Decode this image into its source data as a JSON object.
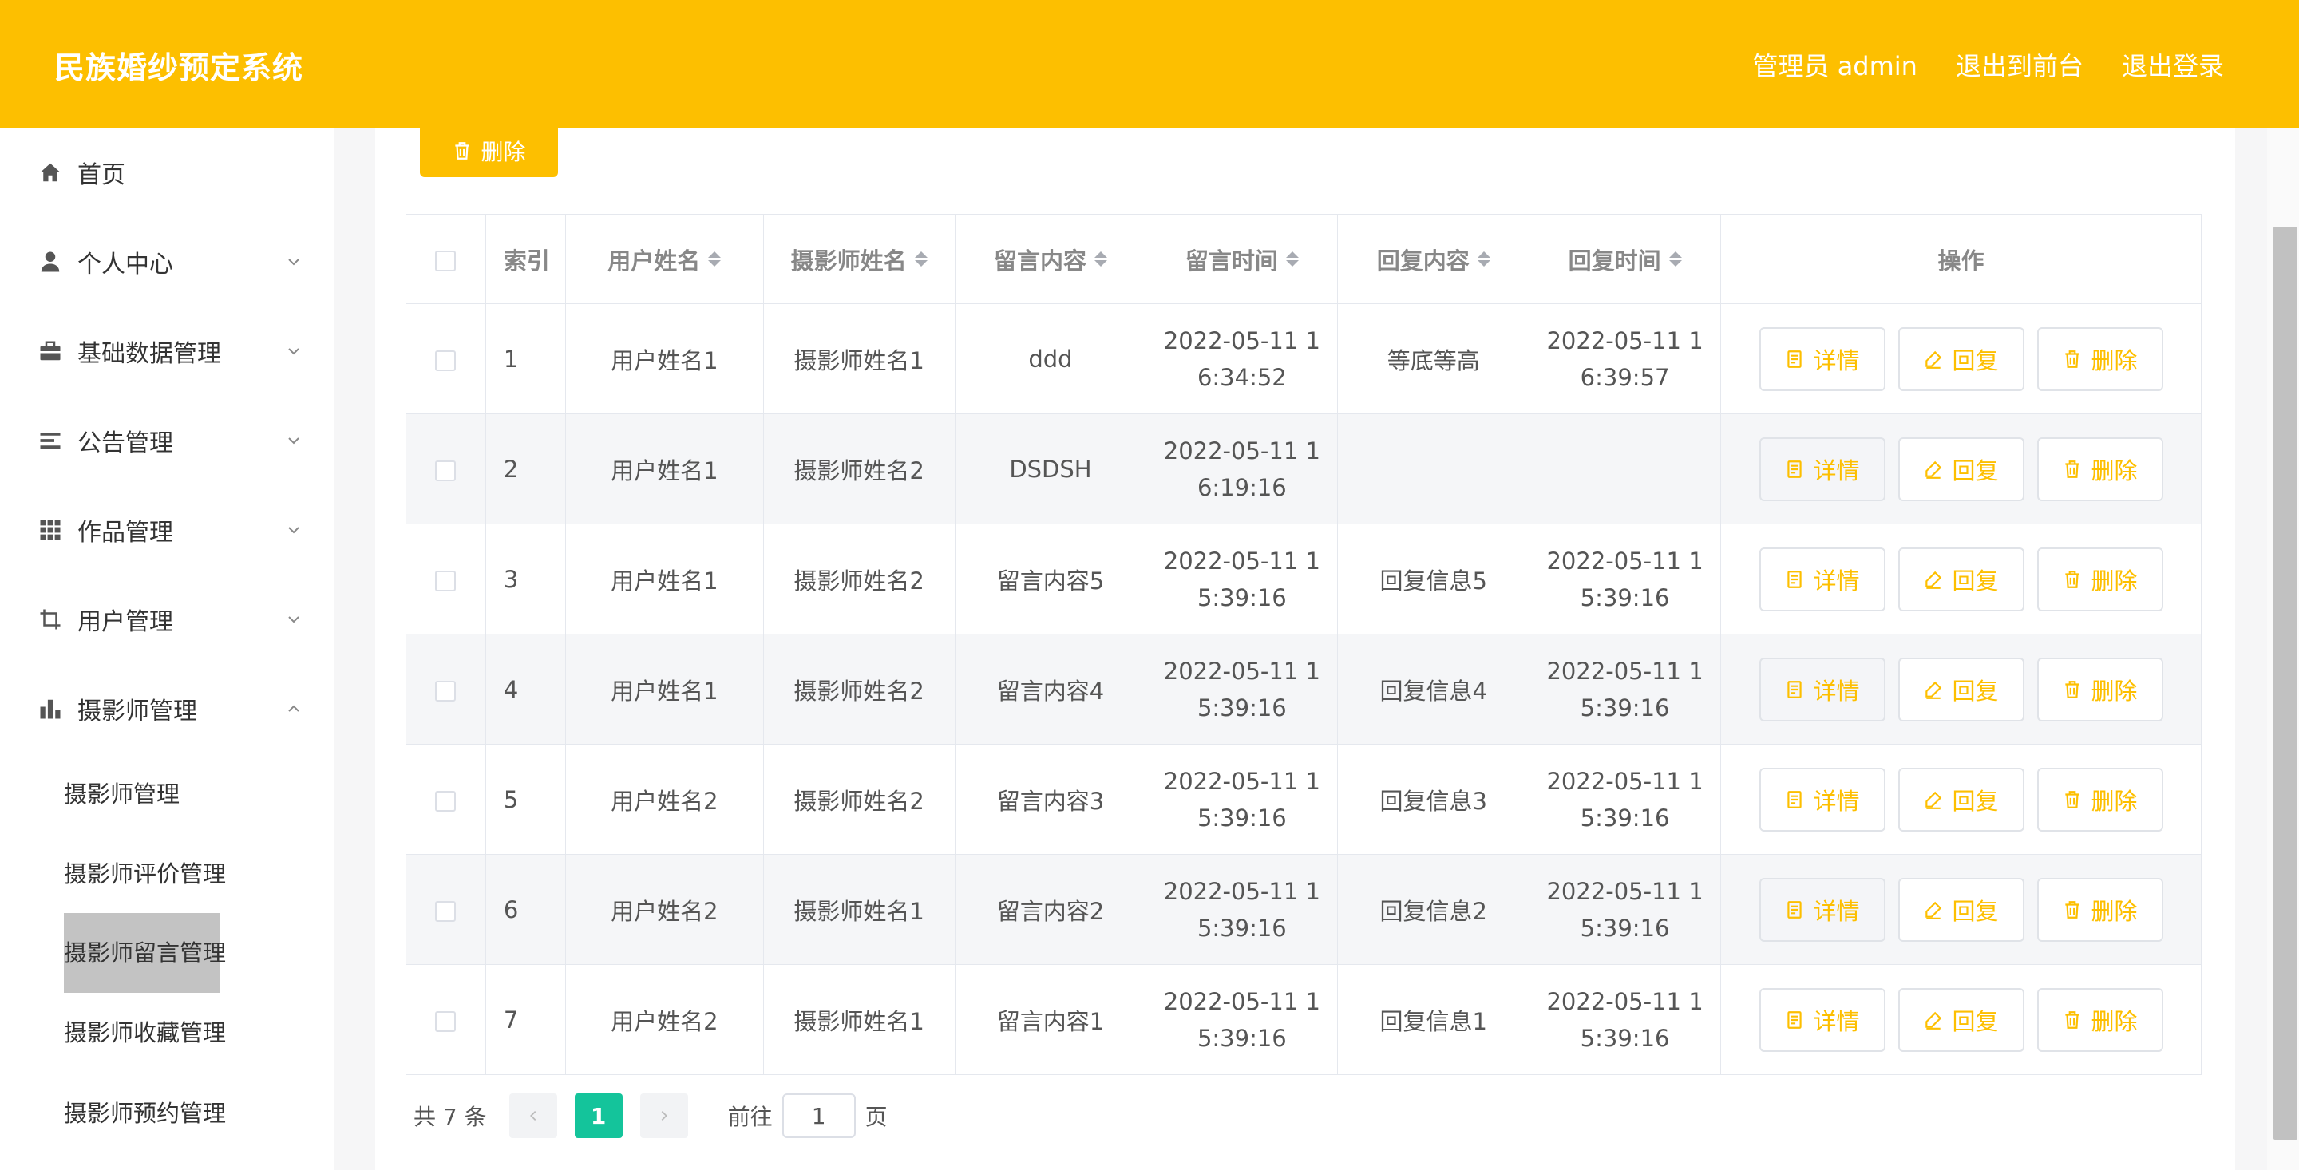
{
  "header": {
    "title": "民族婚纱预定系统",
    "links": [
      "管理员 admin",
      "退出到前台",
      "退出登录"
    ]
  },
  "sidebar": {
    "items": [
      {
        "label": "首页",
        "icon": "home-icon"
      },
      {
        "label": "个人中心",
        "icon": "user-icon"
      },
      {
        "label": "基础数据管理",
        "icon": "briefcase-icon"
      },
      {
        "label": "公告管理",
        "icon": "list-icon"
      },
      {
        "label": "作品管理",
        "icon": "grid-icon"
      },
      {
        "label": "用户管理",
        "icon": "crop-icon"
      },
      {
        "label": "摄影师管理",
        "icon": "bar-chart-icon"
      }
    ],
    "sub_items": [
      "摄影师管理",
      "摄影师评价管理",
      "摄影师留言管理",
      "摄影师收藏管理",
      "摄影师预约管理"
    ],
    "active_sub": "摄影师留言管理"
  },
  "toolbar": {
    "delete_label": "删除"
  },
  "table": {
    "headers": [
      "索引",
      "用户姓名",
      "摄影师姓名",
      "留言内容",
      "留言时间",
      "回复内容",
      "回复时间",
      "操作"
    ],
    "rows": [
      {
        "idx": "1",
        "user": "用户姓名1",
        "photographer": "摄影师姓名1",
        "content": "ddd",
        "time_a": "2022-05-11 1",
        "time_b": "6:34:52",
        "reply": "等底等高",
        "rtime_a": "2022-05-11 1",
        "rtime_b": "6:39:57"
      },
      {
        "idx": "2",
        "user": "用户姓名1",
        "photographer": "摄影师姓名2",
        "content": "DSDSH",
        "time_a": "2022-05-11 1",
        "time_b": "6:19:16",
        "reply": "",
        "rtime_a": "",
        "rtime_b": ""
      },
      {
        "idx": "3",
        "user": "用户姓名1",
        "photographer": "摄影师姓名2",
        "content": "留言内容5",
        "time_a": "2022-05-11 1",
        "time_b": "5:39:16",
        "reply": "回复信息5",
        "rtime_a": "2022-05-11 1",
        "rtime_b": "5:39:16"
      },
      {
        "idx": "4",
        "user": "用户姓名1",
        "photographer": "摄影师姓名2",
        "content": "留言内容4",
        "time_a": "2022-05-11 1",
        "time_b": "5:39:16",
        "reply": "回复信息4",
        "rtime_a": "2022-05-11 1",
        "rtime_b": "5:39:16"
      },
      {
        "idx": "5",
        "user": "用户姓名2",
        "photographer": "摄影师姓名2",
        "content": "留言内容3",
        "time_a": "2022-05-11 1",
        "time_b": "5:39:16",
        "reply": "回复信息3",
        "rtime_a": "2022-05-11 1",
        "rtime_b": "5:39:16"
      },
      {
        "idx": "6",
        "user": "用户姓名2",
        "photographer": "摄影师姓名1",
        "content": "留言内容2",
        "time_a": "2022-05-11 1",
        "time_b": "5:39:16",
        "reply": "回复信息2",
        "rtime_a": "2022-05-11 1",
        "rtime_b": "5:39:16"
      },
      {
        "idx": "7",
        "user": "用户姓名2",
        "photographer": "摄影师姓名1",
        "content": "留言内容1",
        "time_a": "2022-05-11 1",
        "time_b": "5:39:16",
        "reply": "回复信息1",
        "rtime_a": "2022-05-11 1",
        "rtime_b": "5:39:16"
      }
    ],
    "actions": {
      "detail": "详情",
      "reply": "回复",
      "delete": "删除"
    }
  },
  "pagination": {
    "total_text": "共 7 条",
    "current": "1",
    "goto_label": "前往",
    "goto_value": "1",
    "page_suffix": "页"
  },
  "colors": {
    "accent": "#fdbf00",
    "pager_active": "#14c49b"
  }
}
